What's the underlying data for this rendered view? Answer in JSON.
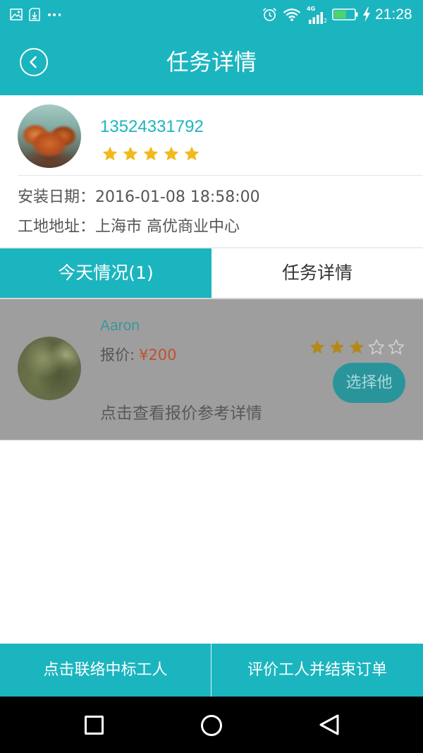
{
  "colors": {
    "accent": "#1bb5bf",
    "star": "#f3b81b",
    "star_dimmed": "#b3891d",
    "star_empty": "#d4d4d4",
    "price": "#c1502c",
    "pressed_overlay": "#9e9e9e"
  },
  "status_bar": {
    "left_icons": [
      "image-icon",
      "sd-card-download-icon",
      "more-notifications-icon"
    ],
    "right_icons": [
      "alarm-clock-icon",
      "wifi-icon",
      "cellular-signal-icon",
      "battery-icon",
      "charging-bolt-icon"
    ],
    "network_type": "4G",
    "sim_slot": "2",
    "battery_level": 0.6,
    "charging": true,
    "time": "21:28"
  },
  "header": {
    "back_icon": "chevron-left-icon",
    "title": "任务详情"
  },
  "client": {
    "phone": "13524331792",
    "rating": 5,
    "max_rating": 5,
    "install_date_label": "安装日期：",
    "install_date": "2016-01-08 18:58:00",
    "address_label": "工地地址：",
    "address": "上海市 高优商业中心"
  },
  "tabs": [
    {
      "label": "今天情况(1)",
      "active": true
    },
    {
      "label": "任务详情",
      "active": false
    }
  ],
  "workers": [
    {
      "name": "Aaron",
      "price_label": "报价:",
      "price": "¥200",
      "rating": 3,
      "max_rating": 5,
      "select_label": "选择他",
      "detail_label": "点击查看报价参考详情",
      "pressed": true
    }
  ],
  "footer": {
    "contact_label": "点击联络中标工人",
    "finish_label": "评价工人并结束订单"
  },
  "nav_bar": {
    "icons": [
      "recent-apps-square-icon",
      "home-circle-icon",
      "back-triangle-icon"
    ]
  }
}
